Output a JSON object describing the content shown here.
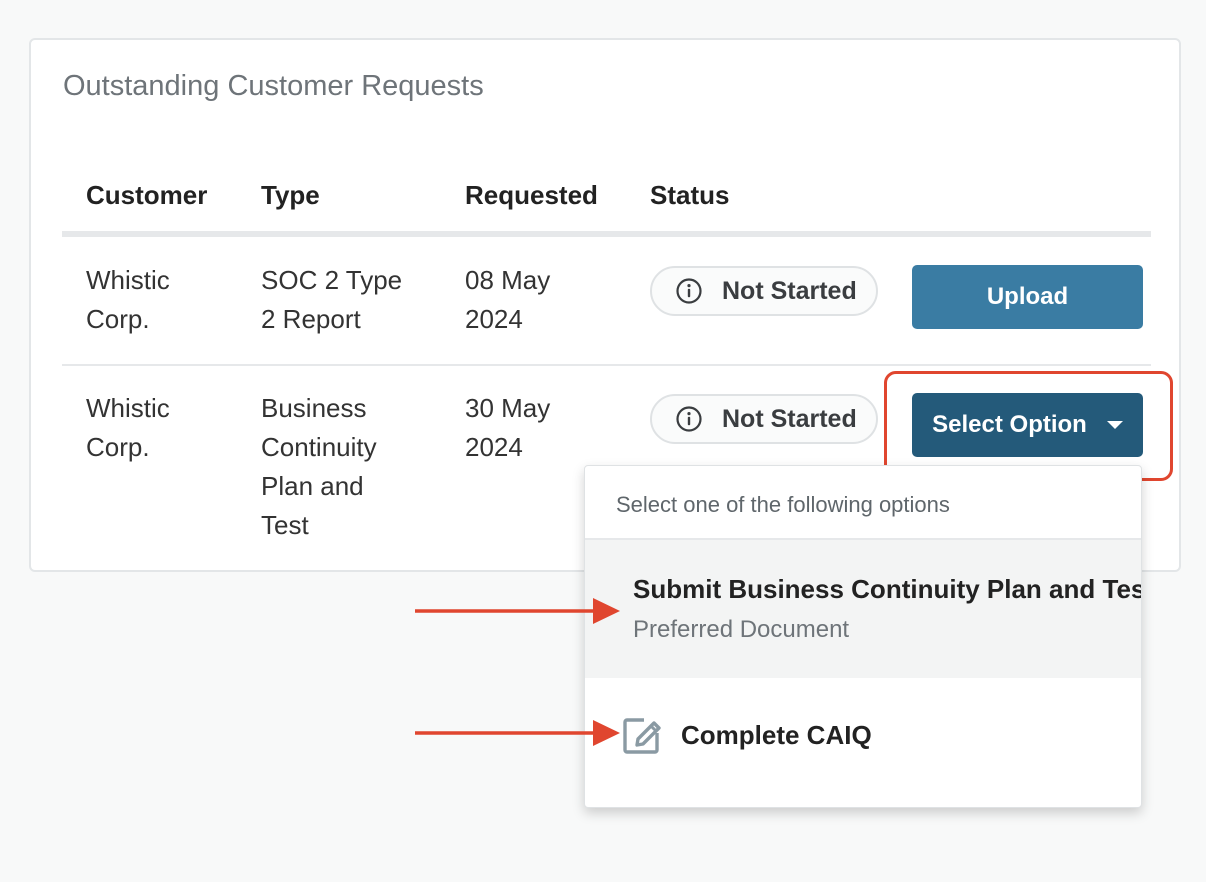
{
  "card": {
    "title": "Outstanding Customer Requests"
  },
  "table": {
    "headers": [
      "Customer",
      "Type",
      "Requested",
      "Status"
    ],
    "rows": [
      {
        "customer": [
          "Whistic",
          "Corp."
        ],
        "type": [
          "SOC 2 Type",
          "2 Report"
        ],
        "requested": [
          "08 May",
          "2024"
        ],
        "status": "Not Started",
        "action": "Upload"
      },
      {
        "customer": [
          "Whistic",
          "Corp."
        ],
        "type": [
          "Business",
          "Continuity",
          "Plan and",
          "Test"
        ],
        "requested": [
          "30 May",
          "2024"
        ],
        "status": "Not Started",
        "action": "Select Option"
      }
    ]
  },
  "dropdown": {
    "hint": "Select one of the following options",
    "options": [
      {
        "title": "Submit Business Continuity Plan and Test",
        "subtitle": "Preferred Document",
        "icon": "none"
      },
      {
        "title": "Complete CAIQ",
        "icon": "edit-icon"
      }
    ]
  },
  "colors": {
    "upload_button": "#3a7ca3",
    "select_button": "#245a7a",
    "annotation_red": "#e0462f",
    "selected_option_bg": "#f3f4f4"
  }
}
